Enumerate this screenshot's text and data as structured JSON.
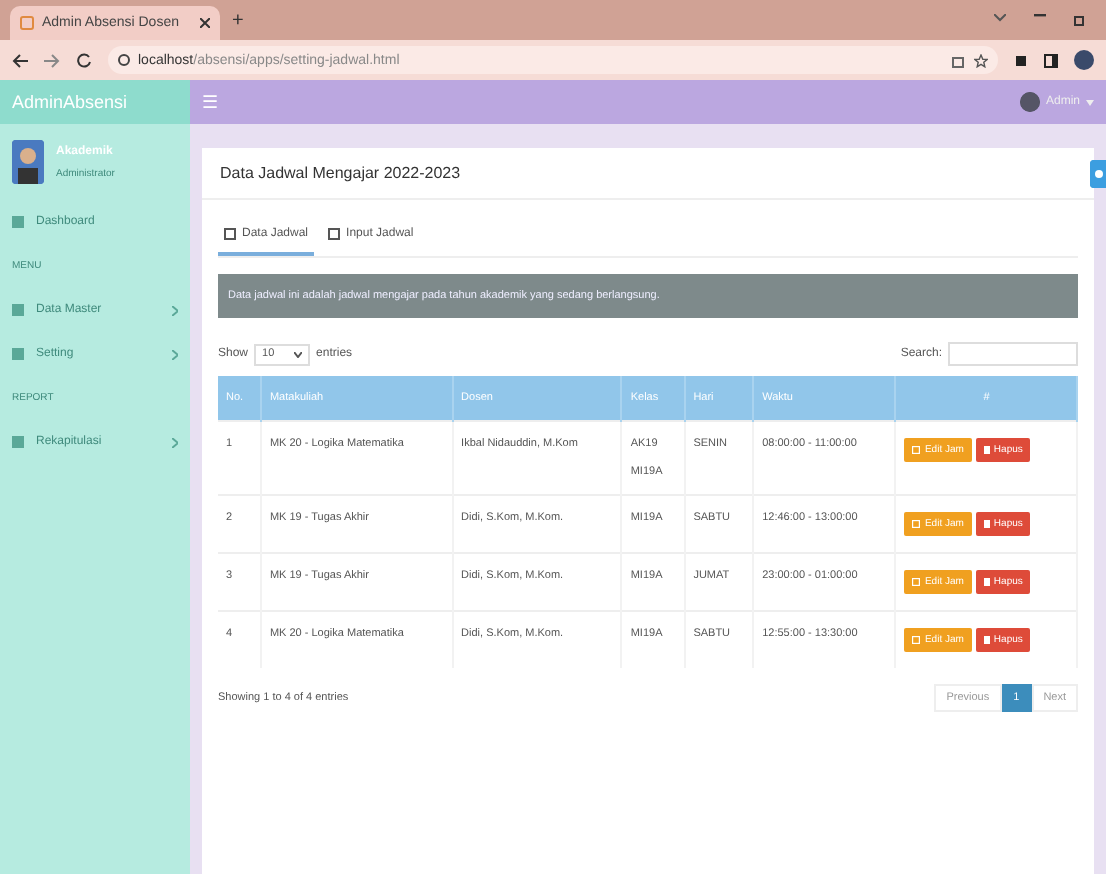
{
  "browser": {
    "tab_title": "Admin Absensi Dosen",
    "new_tab": "+",
    "url_host": "localhost",
    "url_path": "/absensi/apps/setting-jadwal.html"
  },
  "brand": "AdminAbsensi",
  "user": {
    "name": "Akademik",
    "role": "Administrator"
  },
  "menu": [
    {
      "kind": "item",
      "label": "Dashboard",
      "has_children": false
    },
    {
      "kind": "header",
      "label": "MENU"
    },
    {
      "kind": "item",
      "label": "Data Master",
      "has_children": true
    },
    {
      "kind": "item",
      "label": "Setting",
      "has_children": true
    },
    {
      "kind": "header",
      "label": "REPORT"
    },
    {
      "kind": "item",
      "label": "Rekapitulasi",
      "has_children": true
    }
  ],
  "navbar": {
    "menu_glyph": "☰",
    "user": "Admin"
  },
  "card": {
    "title": "Data Jadwal Mengajar 2022-2023",
    "tabs": [
      {
        "label": "Data Jadwal",
        "selected": true
      },
      {
        "label": "Input Jadwal",
        "selected": false
      }
    ],
    "alert": "Data jadwal ini adalah jadwal mengajar pada tahun akademik yang sedang berlangsung.",
    "show": "Show",
    "length": "10",
    "entries": "entries",
    "search_label": "Search:",
    "columns": [
      "No.",
      "Matakuliah",
      "Dosen",
      "Kelas",
      "Hari",
      "Waktu",
      "#"
    ],
    "rows": [
      {
        "no": "1",
        "matakuliah": "MK 20 - Logika Matematika",
        "dosen": "Ikbal Nidauddin, M.Kom",
        "kelas": [
          "AK19",
          "MI19A"
        ],
        "hari": "SENIN",
        "waktu": "08:00:00 - 11:00:00",
        "edit": "Edit Jam",
        "delete": "Hapus"
      },
      {
        "no": "2",
        "matakuliah": "MK 19 - Tugas Akhir",
        "dosen": "Didi, S.Kom, M.Kom.",
        "kelas": [
          "MI19A"
        ],
        "hari": "SABTU",
        "waktu": "12:46:00 - 13:00:00",
        "edit": "Edit Jam",
        "delete": "Hapus"
      },
      {
        "no": "3",
        "matakuliah": "MK 19 - Tugas Akhir",
        "dosen": "Didi, S.Kom, M.Kom.",
        "kelas": [
          "MI19A"
        ],
        "hari": "JUMAT",
        "waktu": "23:00:00 - 01:00:00",
        "edit": "Edit Jam",
        "delete": "Hapus"
      },
      {
        "no": "4",
        "matakuliah": "MK 20 - Logika Matematika",
        "dosen": "Didi, S.Kom, M.Kom.",
        "kelas": [
          "MI19A"
        ],
        "hari": "SABTU",
        "waktu": "12:55:00 - 13:30:00",
        "edit": "Edit Jam",
        "delete": "Hapus"
      }
    ],
    "info": "Showing 1 to 4 of 4 entries",
    "pages": [
      {
        "label": "Previous",
        "selected": false
      },
      {
        "label": "1",
        "selected": true
      },
      {
        "label": "Next",
        "selected": false
      }
    ]
  }
}
